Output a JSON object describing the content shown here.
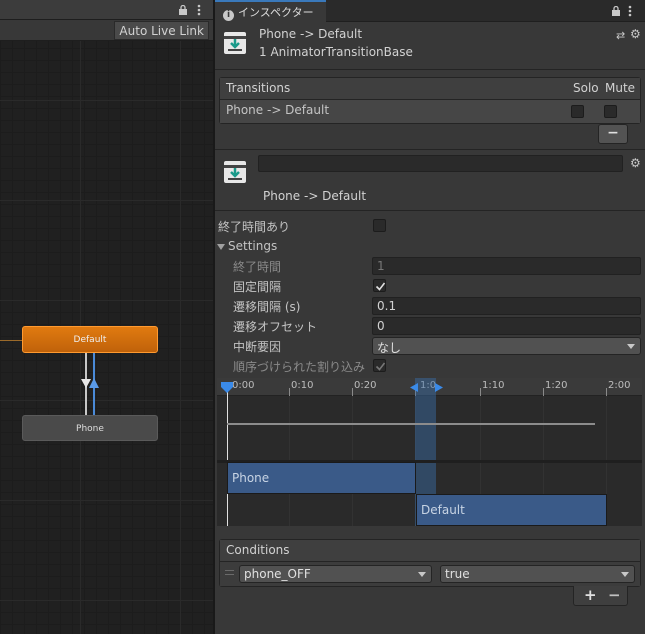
{
  "graph": {
    "live_link_label": "Auto Live Link",
    "nodes": {
      "default": "Default",
      "phone": "Phone"
    }
  },
  "inspector": {
    "tab_label": "インスペクター",
    "header": {
      "title": "Phone -> Default",
      "subtitle": "1 AnimatorTransitionBase"
    },
    "transitions": {
      "header": "Transitions",
      "solo_label": "Solo",
      "mute_label": "Mute",
      "rows": [
        {
          "name": "Phone -> Default"
        }
      ],
      "remove_label": "−"
    },
    "transition": {
      "name_value": "",
      "title": "Phone -> Default"
    },
    "properties": {
      "has_exit_time_label": "終了時間あり",
      "settings_label": "Settings",
      "exit_time_label": "終了時間",
      "exit_time_value": "1",
      "fixed_duration_label": "固定間隔",
      "transition_duration_label": "遷移間隔 (s)",
      "transition_duration_value": "0.1",
      "transition_offset_label": "遷移オフセット",
      "transition_offset_value": "0",
      "interruption_source_label": "中断要因",
      "interruption_source_value": "なし",
      "ordered_interruption_label": "順序づけられた割り込み"
    },
    "timeline": {
      "ticks": [
        "0:00",
        "0:10",
        "0:20",
        "",
        "1:0",
        "1:10",
        "1:20",
        "2:00"
      ],
      "bars": {
        "source": "Phone",
        "destination": "Default"
      }
    },
    "conditions": {
      "header": "Conditions",
      "parameter": "phone_OFF",
      "value": "true",
      "add_label": "+",
      "remove_label": "−"
    }
  },
  "colors": {
    "accent": "#3a79bb",
    "default_state": "#e07a10",
    "bar": "#3a5a88"
  }
}
